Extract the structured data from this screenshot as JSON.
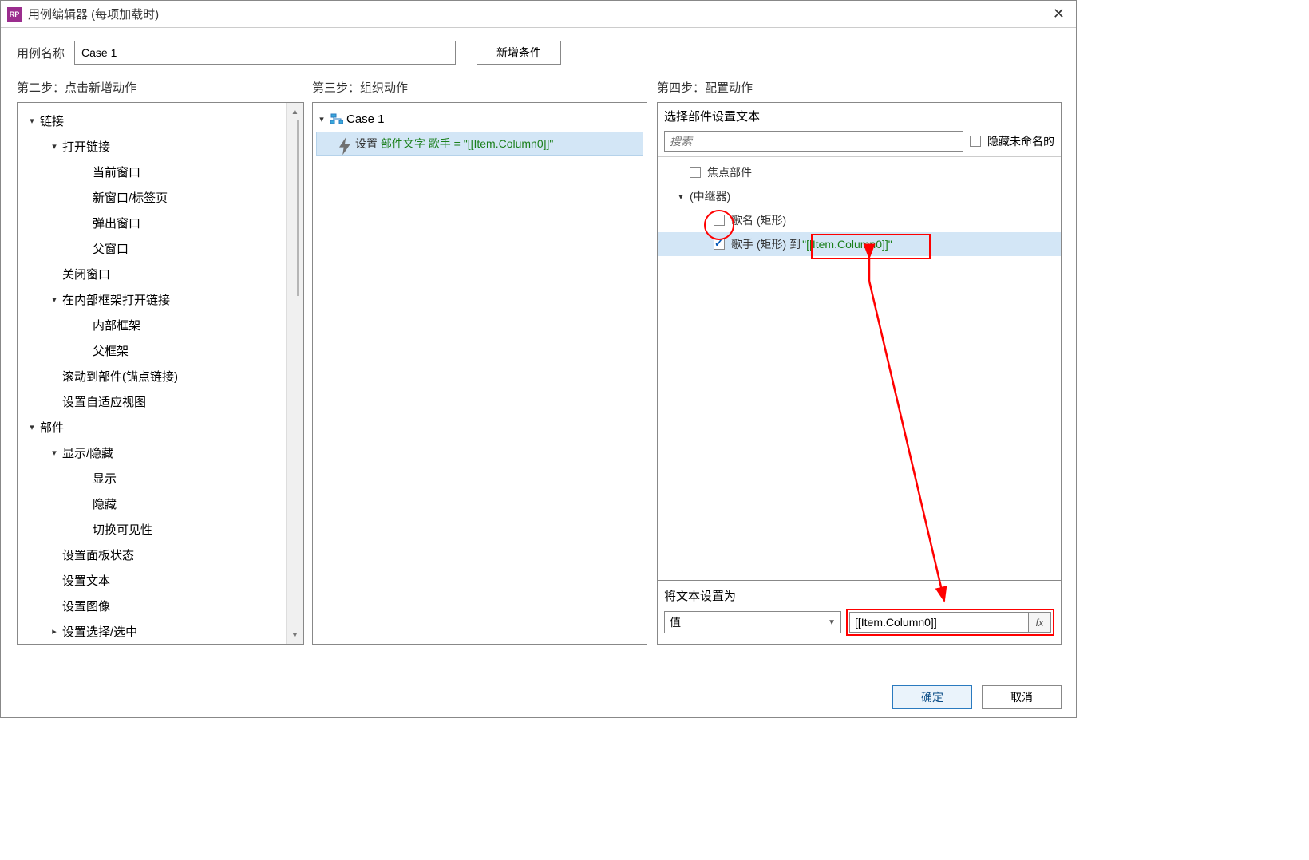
{
  "window": {
    "title": "用例编辑器 (每项加载时)"
  },
  "case": {
    "label": "用例名称",
    "name": "Case 1",
    "add_condition": "新增条件"
  },
  "steps": {
    "s2": "第二步：点击新增动作",
    "s3": "第三步：组织动作",
    "s4": "第四步：配置动作"
  },
  "actions_tree": [
    {
      "label": "链接",
      "depth": 1,
      "caret": "open"
    },
    {
      "label": "打开链接",
      "depth": 2,
      "caret": "open"
    },
    {
      "label": "当前窗口",
      "depth": 3,
      "caret": "leaf"
    },
    {
      "label": "新窗口/标签页",
      "depth": 3,
      "caret": "leaf"
    },
    {
      "label": "弹出窗口",
      "depth": 3,
      "caret": "leaf"
    },
    {
      "label": "父窗口",
      "depth": 3,
      "caret": "leaf"
    },
    {
      "label": "关闭窗口",
      "depth": 2,
      "caret": "leaf"
    },
    {
      "label": "在内部框架打开链接",
      "depth": 2,
      "caret": "open"
    },
    {
      "label": "内部框架",
      "depth": 3,
      "caret": "leaf"
    },
    {
      "label": "父框架",
      "depth": 3,
      "caret": "leaf"
    },
    {
      "label": "滚动到部件(锚点链接)",
      "depth": 2,
      "caret": "leaf"
    },
    {
      "label": "设置自适应视图",
      "depth": 2,
      "caret": "leaf"
    },
    {
      "label": "部件",
      "depth": 1,
      "caret": "open"
    },
    {
      "label": "显示/隐藏",
      "depth": 2,
      "caret": "open"
    },
    {
      "label": "显示",
      "depth": 3,
      "caret": "leaf"
    },
    {
      "label": "隐藏",
      "depth": 3,
      "caret": "leaf"
    },
    {
      "label": "切换可见性",
      "depth": 3,
      "caret": "leaf"
    },
    {
      "label": "设置面板状态",
      "depth": 2,
      "caret": "leaf"
    },
    {
      "label": "设置文本",
      "depth": 2,
      "caret": "leaf"
    },
    {
      "label": "设置图像",
      "depth": 2,
      "caret": "leaf"
    },
    {
      "label": "设置选择/选中",
      "depth": 2,
      "caret": "closed"
    }
  ],
  "case_actions": {
    "case_name": "Case 1",
    "action": {
      "verb": "设置",
      "rest": "部件文字 歌手 = \"[[Item.Column0]]\""
    }
  },
  "step4": {
    "select_widget_title": "选择部件设置文本",
    "search_placeholder": "搜索",
    "hide_unnamed": "隐藏未命名的",
    "widgets": {
      "focus": "焦点部件",
      "repeater": "(中继器)",
      "song": "歌名 (矩形)",
      "singer_prefix": "歌手 (矩形) 到",
      "singer_var": "\"[[Item.Column0]]\""
    },
    "set_text_title": "将文本设置为",
    "value_option": "值",
    "value_expr": "[[Item.Column0]]",
    "fx": "fx"
  },
  "buttons": {
    "ok": "确定",
    "cancel": "取消"
  }
}
